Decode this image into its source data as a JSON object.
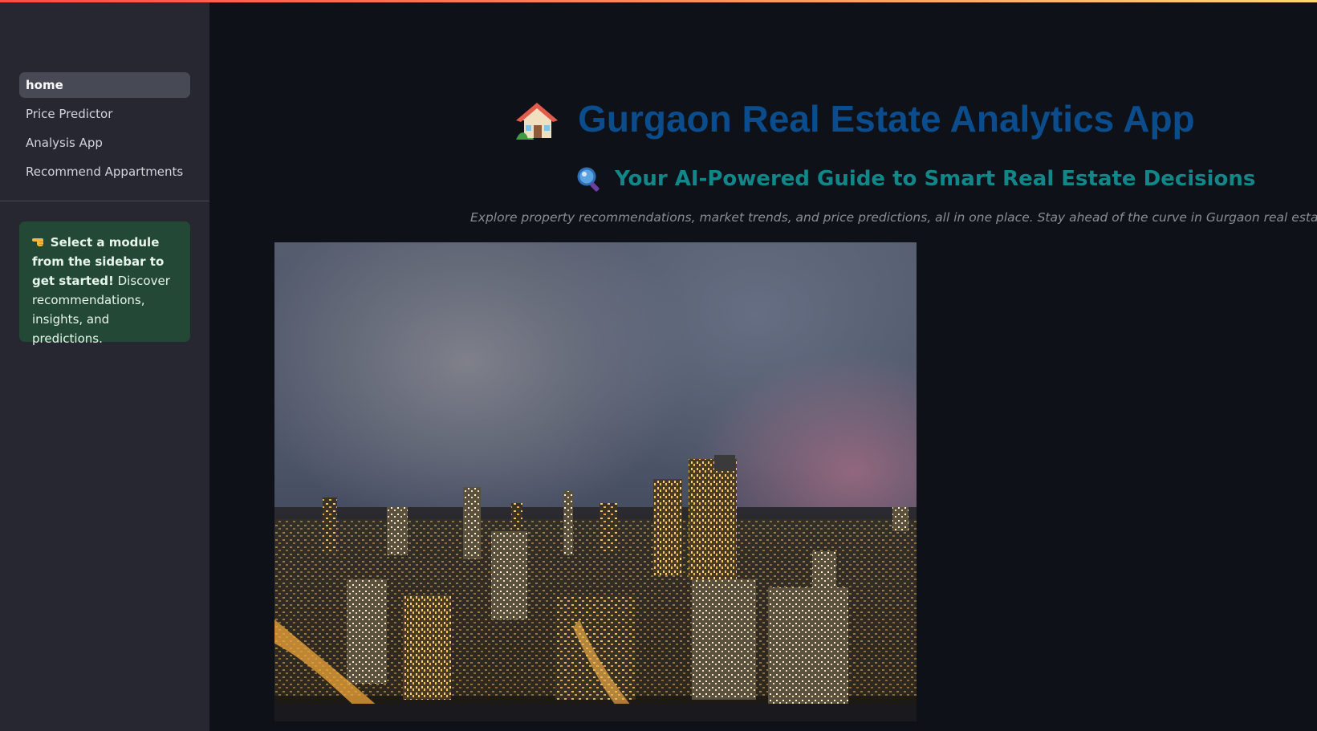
{
  "sidebar": {
    "nav_items": [
      {
        "label": "home",
        "active": true
      },
      {
        "label": "Price Predictor",
        "active": false
      },
      {
        "label": "Analysis App",
        "active": false
      },
      {
        "label": "Recommend Appartments",
        "active": false
      }
    ],
    "info": {
      "icon": "pointing-hand-icon",
      "bold_text": "Select a module from the sidebar to get started!",
      "text": "Discover recommendations, insights, and predictions."
    }
  },
  "main": {
    "title": "Gurgaon Real Estate Analytics App",
    "title_icon": "house-icon",
    "subtitle": "Your AI-Powered Guide to Smart Real Estate Decisions",
    "subtitle_icon": "magnifier-icon",
    "tagline": "Explore property recommendations, market trends, and price predictions, all in one place. Stay ahead of the curve in Gurgaon real estate!",
    "hero_image": "city-skyline-night-photo"
  },
  "colors": {
    "background": "#0e1117",
    "sidebar": "#262730",
    "nav_active": "#474954",
    "info_box": "#234936",
    "title": "#0b4c8c",
    "subtitle": "#12878a",
    "tagline": "#8b8d94"
  }
}
